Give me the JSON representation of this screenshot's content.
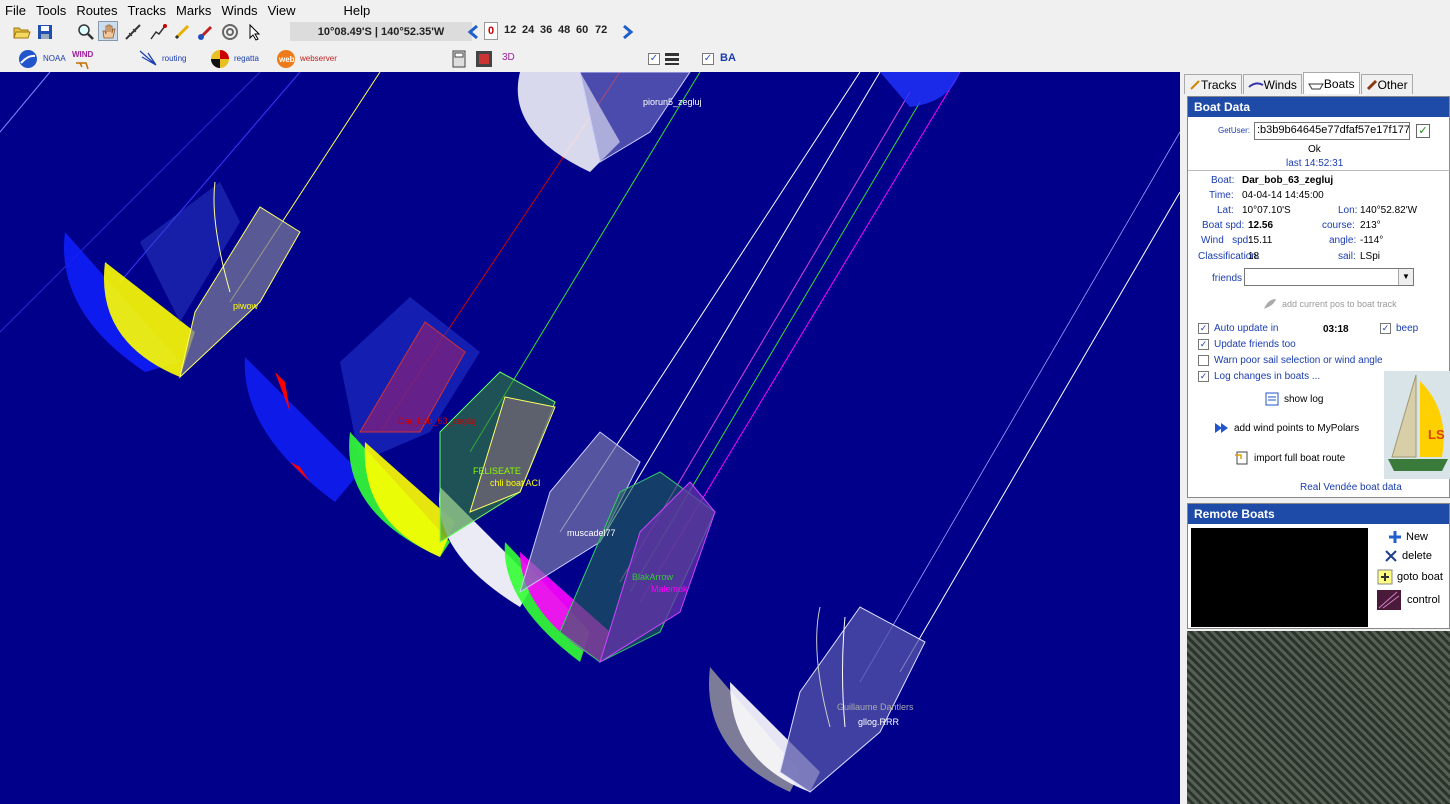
{
  "menu": [
    "File",
    "Tools",
    "Routes",
    "Tracks",
    "Marks",
    "Winds",
    "View",
    "Help"
  ],
  "toolbar": {
    "coords": "10°08.49'S | 140°52.35'W",
    "hours": [
      "0",
      "12",
      "24",
      "36",
      "48",
      "60",
      "72"
    ],
    "selected_hour": "0",
    "check_label": "BA",
    "three_d": "3D"
  },
  "toolbar2": {
    "noaa": "NOAA",
    "wind": "WIND",
    "routing": "routing",
    "regatta": "regatta",
    "webserver": "webserver"
  },
  "tabs": [
    "Tracks",
    "Winds",
    "Boats",
    "Other"
  ],
  "active_tab": "Boats",
  "boat_data": {
    "title": "Boat Data",
    "getuser_label": "GetUser:",
    "getuser_value": ":b3b9b64645e77dfaf57e17f177",
    "status": "Ok",
    "last": "last 14:52:31",
    "boat_label": "Boat:",
    "boat": "Dar_bob_63_zegluj",
    "time_label": "Time:",
    "time": "04-04-14 14:45:00",
    "lat_label": "Lat:",
    "lat": "10°07.10'S",
    "lon_label": "Lon:",
    "lon": "140°52.82'W",
    "spd_label": "Boat spd:",
    "spd": "12.56",
    "course_label": "course:",
    "course": "213°",
    "wind_label": "Wind   spd:",
    "wind": "15.11",
    "angle_label": "angle:",
    "angle": "-114°",
    "class_label": "Classification:",
    "class": "18",
    "sail_label": "sail:",
    "sail": "LSpi",
    "friends_label": "friends",
    "add_pos": "add current pos to boat track",
    "auto_update": "Auto update in",
    "auto_time": "03:18",
    "beep": "beep",
    "update_friends": "Update friends too",
    "warn": "Warn poor sail selection or wind angle",
    "log_changes": "Log changes in boats ...",
    "show_log": "show log",
    "add_wind": "add wind points to MyPolars",
    "import_route": "import full boat route",
    "real_vendee": "Real Vendée boat data",
    "sail_badge": "LS"
  },
  "remote_boats": {
    "title": "Remote Boats",
    "new": "New",
    "delete": "delete",
    "goto": "goto boat",
    "control": "control"
  },
  "boats": [
    {
      "name": "piorun5_zegluj",
      "color": "#ffffff"
    },
    {
      "name": "piwow",
      "color": "#ffff00"
    },
    {
      "name": "Dar_bob_63_zegluj",
      "color": "#cc0000"
    },
    {
      "name": "FELISEATE",
      "color": "#88ff00"
    },
    {
      "name": "chli boat ACI",
      "color": "#ffff00"
    },
    {
      "name": "muscadel77",
      "color": "#ffffff"
    },
    {
      "name": "BlakArrow",
      "color": "#33cc33"
    },
    {
      "name": "Malemuk",
      "color": "#ff00ff"
    },
    {
      "name": "Guillaume Dantlers",
      "color": "#aaaaaa"
    },
    {
      "name": "gllog.RRR",
      "color": "#ffffff"
    }
  ],
  "colors": {
    "sea": "#00008b",
    "panel_title": "#1e4ba8"
  }
}
